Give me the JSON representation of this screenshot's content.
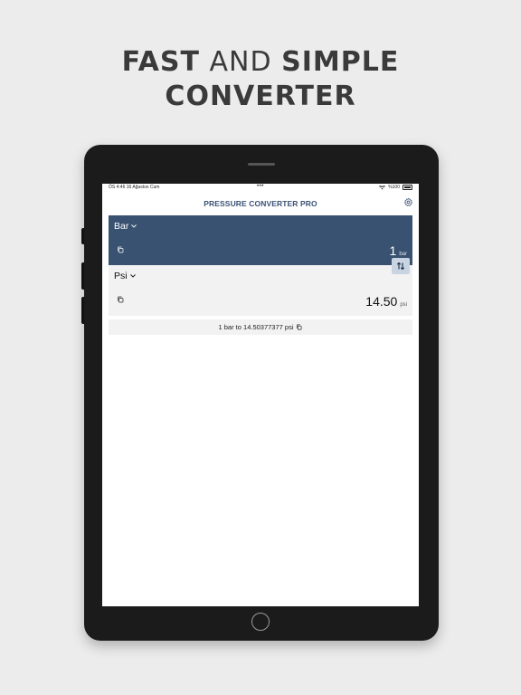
{
  "headline": {
    "line1_bold1": "FAST",
    "line1_light": "AND",
    "line1_bold2": "SIMPLE",
    "line2": "CONVERTER"
  },
  "status_bar": {
    "time_date": "ÖS 4:46   16 Ağustos Cum",
    "dots": "•••",
    "battery_text": "%100",
    "icons": [
      "wifi-icon",
      "battery-icon"
    ]
  },
  "navbar": {
    "title": "PRESSURE CONVERTER PRO",
    "settings_icon": "gear-icon"
  },
  "from_card": {
    "unit_label": "Bar",
    "value": "1",
    "unit_abbr": "bar",
    "background": "#395271"
  },
  "to_card": {
    "unit_label": "Psi",
    "value": "14.50",
    "unit_abbr": "psi",
    "background": "#f2f2f2"
  },
  "swap_button": {
    "icon": "swap-vertical-icon"
  },
  "result": {
    "text": "1 bar to 14.50377377 psi",
    "icon": "copy-icon"
  },
  "colors": {
    "accent": "#3b5276",
    "page_background": "#ececec",
    "device_frame": "#1b1b1b"
  }
}
